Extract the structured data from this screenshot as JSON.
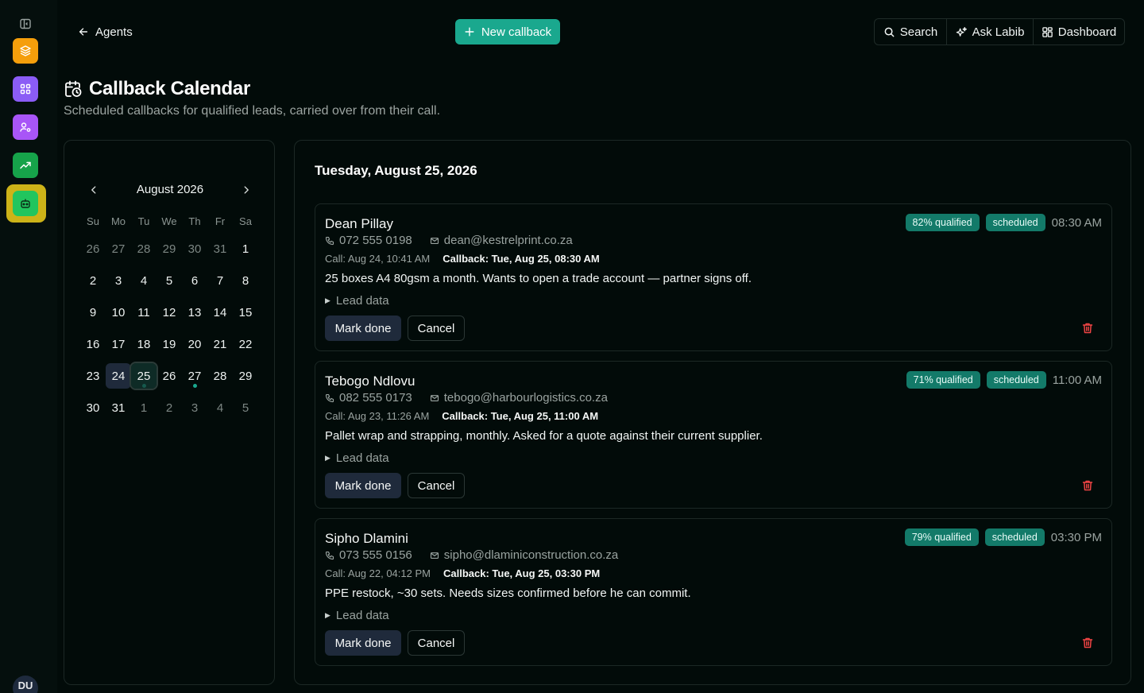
{
  "nav": {
    "back_label": "Agents",
    "new_callback_label": "New callback",
    "search_label": "Search",
    "ask_label": "Ask Labib",
    "dashboard_label": "Dashboard",
    "user_initials": "DU"
  },
  "rail": {
    "items": [
      {
        "icon": "layers-icon",
        "color": "#f59e0b"
      },
      {
        "icon": "command-icon",
        "color": "#8b5cf6"
      },
      {
        "icon": "user-settings-icon",
        "color": "#a855f7"
      },
      {
        "icon": "trending-up-icon",
        "color": "#16a34a"
      },
      {
        "icon": "bot-icon",
        "color": "#22c55e",
        "active": true
      }
    ]
  },
  "header": {
    "title": "Callback Calendar",
    "subtitle": "Scheduled callbacks for qualified leads, carried over from their call."
  },
  "calendar": {
    "month_label": "August 2026",
    "weekdays": [
      "Su",
      "Mo",
      "Tu",
      "We",
      "Th",
      "Fr",
      "Sa"
    ],
    "weeks": [
      [
        "26",
        "27",
        "28",
        "29",
        "30",
        "31",
        "1"
      ],
      [
        "2",
        "3",
        "4",
        "5",
        "6",
        "7",
        "8"
      ],
      [
        "9",
        "10",
        "11",
        "12",
        "13",
        "14",
        "15"
      ],
      [
        "16",
        "17",
        "18",
        "19",
        "20",
        "21",
        "22"
      ],
      [
        "23",
        "24",
        "25",
        "26",
        "27",
        "28",
        "29"
      ],
      [
        "30",
        "31",
        "1",
        "2",
        "3",
        "4",
        "5"
      ]
    ],
    "today": "24",
    "selected": "25",
    "days_with_callbacks": [
      "25",
      "27"
    ]
  },
  "day_view": {
    "heading": "Tuesday, August 25, 2026",
    "callbacks": [
      {
        "name": "Dean Pillay",
        "phone": "072 555 0198",
        "email": "dean@kestrelprint.co.za",
        "call_time": "Call: Aug 24, 10:41 AM",
        "callback_time": "Callback: Tue, Aug 25, 08:30 AM",
        "note": "25 boxes A4 80gsm a month. Wants to open a trade account — partner signs off.",
        "lead_data_label": "Lead data",
        "qualified": "82% qualified",
        "status": "scheduled",
        "slot": "08:30 AM",
        "mark_done_label": "Mark done",
        "cancel_label": "Cancel"
      },
      {
        "name": "Tebogo Ndlovu",
        "phone": "082 555 0173",
        "email": "tebogo@harbourlogistics.co.za",
        "call_time": "Call: Aug 23, 11:26 AM",
        "callback_time": "Callback: Tue, Aug 25, 11:00 AM",
        "note": "Pallet wrap and strapping, monthly. Asked for a quote against their current supplier.",
        "lead_data_label": "Lead data",
        "qualified": "71% qualified",
        "status": "scheduled",
        "slot": "11:00 AM",
        "mark_done_label": "Mark done",
        "cancel_label": "Cancel"
      },
      {
        "name": "Sipho Dlamini",
        "phone": "073 555 0156",
        "email": "sipho@dlaminiconstruction.co.za",
        "call_time": "Call: Aug 22, 04:12 PM",
        "callback_time": "Callback: Tue, Aug 25, 03:30 PM",
        "note": "PPE restock, ~30 sets. Needs sizes confirmed before he can commit.",
        "lead_data_label": "Lead data",
        "qualified": "79% qualified",
        "status": "scheduled",
        "slot": "03:30 PM",
        "mark_done_label": "Mark done",
        "cancel_label": "Cancel"
      }
    ]
  }
}
